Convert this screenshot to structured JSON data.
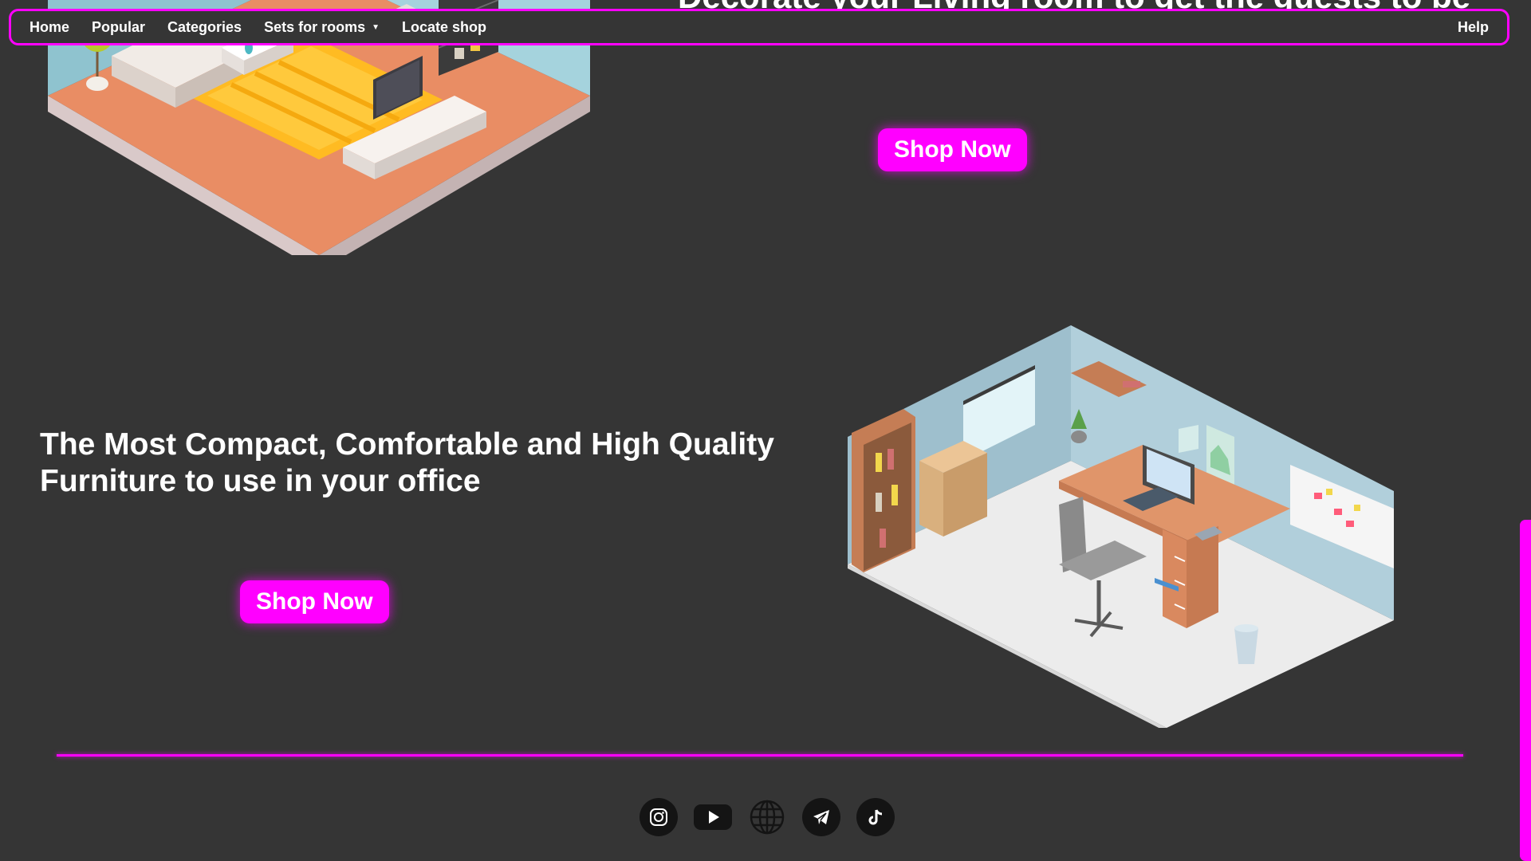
{
  "nav": {
    "items": [
      {
        "label": "Home"
      },
      {
        "label": "Popular"
      },
      {
        "label": "Categories"
      },
      {
        "label": "Sets for rooms",
        "caret": "▼"
      },
      {
        "label": "Locate shop"
      }
    ],
    "help_label": "Help"
  },
  "living_section": {
    "heading": "Decorate your Living room to get the guests to be",
    "shop_label": "Shop Now"
  },
  "office_section": {
    "heading": "The Most Compact, Comfortable and High Quality Furniture to use in your office",
    "shop_label": "Shop Now"
  },
  "footer": {
    "social": [
      {
        "icon": "instagram-icon"
      },
      {
        "icon": "youtube-icon"
      },
      {
        "icon": "globe-icon"
      },
      {
        "icon": "telegram-icon"
      },
      {
        "icon": "tiktok-icon"
      }
    ]
  },
  "colors": {
    "accent": "#ff00ff",
    "background": "#353535",
    "text": "#ffffff"
  }
}
